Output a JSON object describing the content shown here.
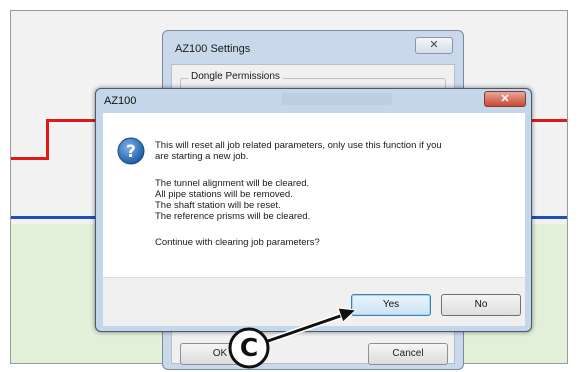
{
  "settings_window": {
    "title": "AZ100 Settings",
    "close_glyph": "✕",
    "group_label": "Dongle Permissions",
    "ok_label": "OK",
    "cancel_label": "Cancel"
  },
  "dialog": {
    "title": "AZ100",
    "close_glyph": "✕",
    "icon": "question-icon",
    "message_line1": "This will reset all job related parameters, only use this function if you",
    "message_line2": "are starting a new job.",
    "details": [
      "The tunnel alignment will be cleared.",
      "All pipe stations will be removed.",
      "The shaft station will be reset.",
      "The reference prisms will be cleared."
    ],
    "prompt": "Continue with clearing job parameters?",
    "yes_label": "Yes",
    "no_label": "No"
  },
  "callout": {
    "letter": "C"
  },
  "colors": {
    "alignment_red": "#e01818",
    "alignment_blue": "#1f4fbf",
    "background_green": "#e2f0d9",
    "dialog_frame": "#c4d6ea"
  }
}
